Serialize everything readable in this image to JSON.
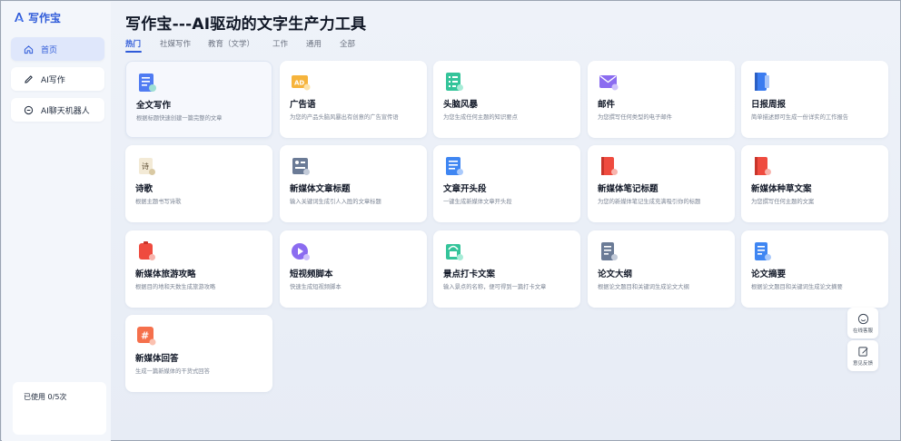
{
  "app": {
    "logo_text": "写作宝"
  },
  "sidebar": {
    "items": [
      {
        "label": "首页",
        "icon": "home-icon",
        "active": true
      },
      {
        "label": "AI写作",
        "icon": "pen-icon",
        "active": false
      },
      {
        "label": "AI聊天机器人",
        "icon": "chat-icon",
        "active": false
      }
    ],
    "usage": "已使用 0/5次"
  },
  "header": {
    "title": "写作宝---AI驱动的文字生产力工具"
  },
  "tabs": [
    {
      "label": "热门",
      "active": true
    },
    {
      "label": "社媒写作",
      "active": false
    },
    {
      "label": "教育（文学）",
      "active": false
    },
    {
      "label": "工作",
      "active": false
    },
    {
      "label": "通用",
      "active": false
    },
    {
      "label": "全部",
      "active": false
    }
  ],
  "cards": [
    {
      "title": "全文写作",
      "desc": "根据标题快速创建一篇完整的文章",
      "icon": "document-blue-icon"
    },
    {
      "title": "广告语",
      "desc": "为您的产品头脑风暴出有创意的广告宣传语",
      "icon": "ad-icon"
    },
    {
      "title": "头脑风暴",
      "desc": "为您生成任何主题的知识要点",
      "icon": "checklist-icon"
    },
    {
      "title": "邮件",
      "desc": "为您撰写任何类型的电子邮件",
      "icon": "mail-icon"
    },
    {
      "title": "日报周报",
      "desc": "简单描述即可生成一份详实的工作报告",
      "icon": "report-book-icon"
    },
    {
      "title": "诗歌",
      "desc": "根据主题书写诗歌",
      "icon": "poem-icon"
    },
    {
      "title": "新媒体文章标题",
      "desc": "输入关键词生成引人入胜的文章标题",
      "icon": "article-title-icon"
    },
    {
      "title": "文章开头段",
      "desc": "一键生成新媒体文章开头段",
      "icon": "article-intro-icon"
    },
    {
      "title": "新媒体笔记标题",
      "desc": "为您的新媒体笔记生成充满吸引你的标题",
      "icon": "note-title-icon"
    },
    {
      "title": "新媒体种草文案",
      "desc": "为您撰写任何主题的文案",
      "icon": "promo-copy-icon"
    },
    {
      "title": "新媒体旅游攻略",
      "desc": "根据目的地和天数生成旅游攻略",
      "icon": "travel-guide-icon"
    },
    {
      "title": "短视频脚本",
      "desc": "快速生成短视频脚本",
      "icon": "video-script-icon"
    },
    {
      "title": "景点打卡文案",
      "desc": "输入景点的名称，便可得到一篇打卡文章",
      "icon": "checkin-icon"
    },
    {
      "title": "论文大纲",
      "desc": "根据论文题目和关键词生成论文大纲",
      "icon": "thesis-outline-icon"
    },
    {
      "title": "论文摘要",
      "desc": "根据论文题目和关键词生成论文摘要",
      "icon": "thesis-abstract-icon"
    },
    {
      "title": "新媒体回答",
      "desc": "生成一篇新媒体的干货式回答",
      "icon": "hashtag-answer-icon"
    }
  ],
  "floating": {
    "service_label": "在线客服",
    "feedback_label": "意见反馈"
  },
  "colors": {
    "accent": "#2f5bd9",
    "background": "#e9eef7"
  }
}
